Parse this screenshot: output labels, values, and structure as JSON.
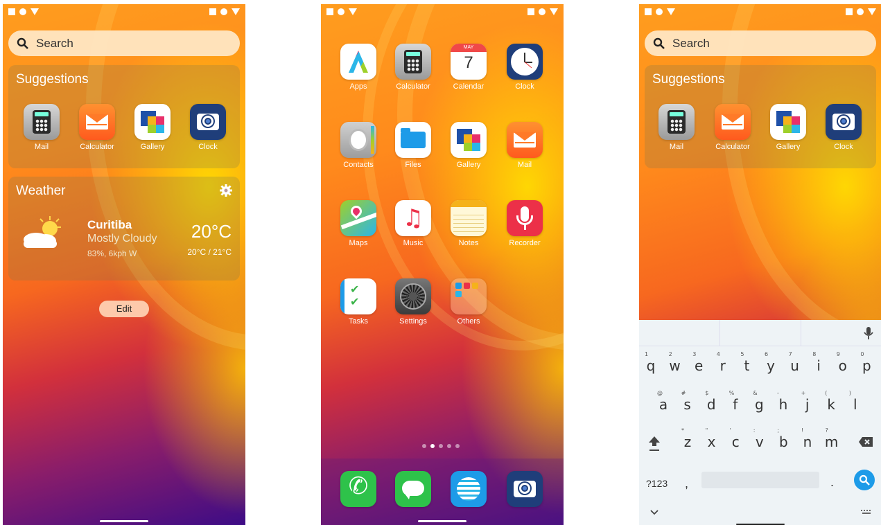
{
  "status": {
    "left": "■ ● ▼",
    "right": "■ ● ▼"
  },
  "search": {
    "placeholder": "Search"
  },
  "suggestions": {
    "title": "Suggestions",
    "apps": [
      {
        "label": "Mail",
        "icon": "calculator-icon"
      },
      {
        "label": "Calculator",
        "icon": "mail-icon"
      },
      {
        "label": "Gallery",
        "icon": "gallery-icon"
      },
      {
        "label": "Clock",
        "icon": "camera-icon"
      }
    ]
  },
  "weather": {
    "title": "Weather",
    "city": "Curitiba",
    "condition": "Mostly Cloudy",
    "details": "83%, 6kph W",
    "temp": "20°C",
    "range": "20°C / 21°C",
    "settings_icon": "gear-icon"
  },
  "edit_label": "Edit",
  "home": {
    "apps": [
      {
        "label": "Apps",
        "icon": "apps"
      },
      {
        "label": "Calculator",
        "icon": "calc"
      },
      {
        "label": "Calendar",
        "icon": "cal"
      },
      {
        "label": "Clock",
        "icon": "clock"
      },
      {
        "label": "Contacts",
        "icon": "contacts"
      },
      {
        "label": "Files",
        "icon": "files"
      },
      {
        "label": "Gallery",
        "icon": "gallery"
      },
      {
        "label": "Mail",
        "icon": "mail"
      },
      {
        "label": "Maps",
        "icon": "maps"
      },
      {
        "label": "Music",
        "icon": "music"
      },
      {
        "label": "Notes",
        "icon": "notes"
      },
      {
        "label": "Recorder",
        "icon": "rec"
      },
      {
        "label": "Tasks",
        "icon": "tasks"
      },
      {
        "label": "Settings",
        "icon": "settings"
      },
      {
        "label": "Others",
        "icon": "others"
      }
    ],
    "calendar": {
      "month": "MAY",
      "day": "7"
    },
    "page_dots": {
      "count": 5,
      "active": 1
    },
    "dock": [
      "phone-icon",
      "messages-icon",
      "browser-icon",
      "camera-icon"
    ]
  },
  "keyboard": {
    "row1": [
      "q",
      "w",
      "e",
      "r",
      "t",
      "y",
      "u",
      "i",
      "o",
      "p"
    ],
    "row1_hints": [
      "1",
      "2",
      "3",
      "4",
      "5",
      "6",
      "7",
      "8",
      "9",
      "0"
    ],
    "row2": [
      "a",
      "s",
      "d",
      "f",
      "g",
      "h",
      "j",
      "k",
      "l"
    ],
    "row2_hints": [
      "@",
      "#",
      "$",
      "%",
      "&",
      "-",
      "+",
      "(",
      ")"
    ],
    "row3": [
      "z",
      "x",
      "c",
      "v",
      "b",
      "n",
      "m"
    ],
    "row3_hints": [
      "*",
      "\"",
      "'",
      ":",
      ";",
      "!",
      "?"
    ],
    "symbols_label": "?123",
    "comma": ",",
    "period": "."
  }
}
